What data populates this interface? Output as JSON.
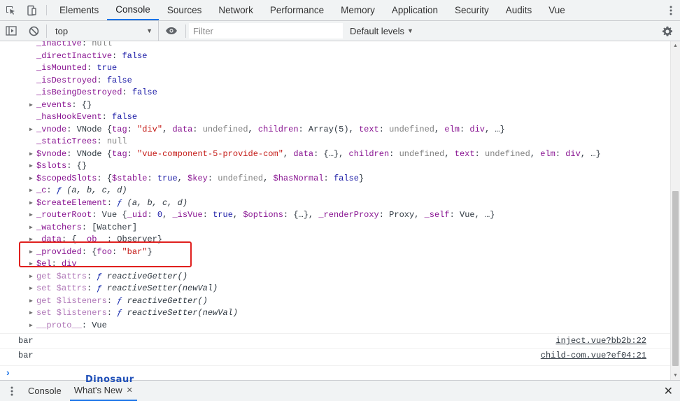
{
  "tabs": [
    {
      "label": "Elements"
    },
    {
      "label": "Console",
      "active": true
    },
    {
      "label": "Sources"
    },
    {
      "label": "Network"
    },
    {
      "label": "Performance"
    },
    {
      "label": "Memory"
    },
    {
      "label": "Application"
    },
    {
      "label": "Security"
    },
    {
      "label": "Audits"
    },
    {
      "label": "Vue"
    }
  ],
  "toolbar": {
    "context": "top",
    "filter_placeholder": "Filter",
    "levels": "Default levels"
  },
  "props": [
    {
      "k": "_inactive",
      "v": [
        [
          "nul",
          "null"
        ]
      ]
    },
    {
      "k": "_directInactive",
      "v": [
        [
          "kw",
          "false"
        ]
      ]
    },
    {
      "k": "_isMounted",
      "v": [
        [
          "kw",
          "true"
        ]
      ]
    },
    {
      "k": "_isDestroyed",
      "v": [
        [
          "kw",
          "false"
        ]
      ]
    },
    {
      "k": "_isBeingDestroyed",
      "v": [
        [
          "kw",
          "false"
        ]
      ]
    },
    {
      "k": "_events",
      "tri": true,
      "v": [
        [
          "pv",
          "{}"
        ]
      ]
    },
    {
      "k": "_hasHookEvent",
      "v": [
        [
          "kw",
          "false"
        ]
      ]
    },
    {
      "k": "_vnode",
      "tri": true,
      "v": [
        [
          "pv",
          "VNode {"
        ],
        [
          "k",
          "tag"
        ],
        [
          "pv",
          ": "
        ],
        [
          "str",
          "\"div\""
        ],
        [
          "pv",
          ", "
        ],
        [
          "k",
          "data"
        ],
        [
          "pv",
          ": "
        ],
        [
          "nul",
          "undefined"
        ],
        [
          "pv",
          ", "
        ],
        [
          "k",
          "children"
        ],
        [
          "pv",
          ": Array(5), "
        ],
        [
          "k",
          "text"
        ],
        [
          "pv",
          ": "
        ],
        [
          "nul",
          "undefined"
        ],
        [
          "pv",
          ", "
        ],
        [
          "k",
          "elm"
        ],
        [
          "pv",
          ": "
        ],
        [
          "k",
          "div"
        ],
        [
          "pv",
          ", …}"
        ]
      ]
    },
    {
      "k": "_staticTrees",
      "v": [
        [
          "nul",
          "null"
        ]
      ]
    },
    {
      "k": "$vnode",
      "tri": true,
      "v": [
        [
          "pv",
          "VNode {"
        ],
        [
          "k",
          "tag"
        ],
        [
          "pv",
          ": "
        ],
        [
          "str",
          "\"vue-component-5-provide-com\""
        ],
        [
          "pv",
          ", "
        ],
        [
          "k",
          "data"
        ],
        [
          "pv",
          ": {…}, "
        ],
        [
          "k",
          "children"
        ],
        [
          "pv",
          ": "
        ],
        [
          "nul",
          "undefined"
        ],
        [
          "pv",
          ", "
        ],
        [
          "k",
          "text"
        ],
        [
          "pv",
          ": "
        ],
        [
          "nul",
          "undefined"
        ],
        [
          "pv",
          ", "
        ],
        [
          "k",
          "elm"
        ],
        [
          "pv",
          ": "
        ],
        [
          "k",
          "div"
        ],
        [
          "pv",
          ", …}"
        ]
      ]
    },
    {
      "k": "$slots",
      "tri": true,
      "v": [
        [
          "pv",
          "{}"
        ]
      ]
    },
    {
      "k": "$scopedSlots",
      "tri": true,
      "v": [
        [
          "pv",
          "{"
        ],
        [
          "k",
          "$stable"
        ],
        [
          "pv",
          ": "
        ],
        [
          "kw",
          "true"
        ],
        [
          "pv",
          ", "
        ],
        [
          "k",
          "$key"
        ],
        [
          "pv",
          ": "
        ],
        [
          "nul",
          "undefined"
        ],
        [
          "pv",
          ", "
        ],
        [
          "k",
          "$hasNormal"
        ],
        [
          "pv",
          ": "
        ],
        [
          "kw",
          "false"
        ],
        [
          "pv",
          "}"
        ]
      ]
    },
    {
      "k": "_c",
      "tri": true,
      "v": [
        [
          "fnf",
          "ƒ"
        ],
        [
          "fn",
          " (a, b, c, d)"
        ]
      ]
    },
    {
      "k": "$createElement",
      "tri": true,
      "v": [
        [
          "fnf",
          "ƒ"
        ],
        [
          "fn",
          " (a, b, c, d)"
        ]
      ]
    },
    {
      "k": "_routerRoot",
      "tri": true,
      "v": [
        [
          "pv",
          "Vue {"
        ],
        [
          "k",
          "_uid"
        ],
        [
          "pv",
          ": "
        ],
        [
          "kw",
          "0"
        ],
        [
          "pv",
          ", "
        ],
        [
          "k",
          "_isVue"
        ],
        [
          "pv",
          ": "
        ],
        [
          "kw",
          "true"
        ],
        [
          "pv",
          ", "
        ],
        [
          "k",
          "$options"
        ],
        [
          "pv",
          ": {…}, "
        ],
        [
          "k",
          "_renderProxy"
        ],
        [
          "pv",
          ": Proxy, "
        ],
        [
          "k",
          "_self"
        ],
        [
          "pv",
          ": Vue, …}"
        ]
      ]
    },
    {
      "k": "_watchers",
      "tri": true,
      "v": [
        [
          "pv",
          "[Watcher]"
        ]
      ]
    },
    {
      "k": "_data",
      "tri": true,
      "v": [
        [
          "pv",
          "{"
        ],
        [
          "k",
          "__ob__"
        ],
        [
          "pv",
          ": Observer}"
        ]
      ]
    },
    {
      "k": "_provided",
      "tri": true,
      "v": [
        [
          "pv",
          "{"
        ],
        [
          "k",
          "foo"
        ],
        [
          "pv",
          ": "
        ],
        [
          "str",
          "\"bar\""
        ],
        [
          "pv",
          "}"
        ]
      ]
    },
    {
      "k": "$el",
      "tri": true,
      "v": [
        [
          "k",
          "div"
        ]
      ]
    },
    {
      "k": "get $attrs",
      "tri": true,
      "dim": true,
      "v": [
        [
          "fnf",
          "ƒ"
        ],
        [
          "fn",
          " reactiveGetter()"
        ]
      ]
    },
    {
      "k": "set $attrs",
      "tri": true,
      "dim": true,
      "v": [
        [
          "fnf",
          "ƒ"
        ],
        [
          "fn",
          " reactiveSetter(newVal)"
        ]
      ]
    },
    {
      "k": "get $listeners",
      "tri": true,
      "dim": true,
      "v": [
        [
          "fnf",
          "ƒ"
        ],
        [
          "fn",
          " reactiveGetter()"
        ]
      ]
    },
    {
      "k": "set $listeners",
      "tri": true,
      "dim": true,
      "v": [
        [
          "fnf",
          "ƒ"
        ],
        [
          "fn",
          " reactiveSetter(newVal)"
        ]
      ]
    },
    {
      "k": "__proto__",
      "tri": true,
      "dim": true,
      "v": [
        [
          "pv",
          "Vue"
        ]
      ]
    }
  ],
  "logs": [
    {
      "msg": "bar",
      "src": "inject.vue?bb2b:22"
    },
    {
      "msg": "bar",
      "src": "child-com.vue?ef04:21"
    }
  ],
  "drawer": {
    "tabs": [
      {
        "label": "Console"
      },
      {
        "label": "What's New",
        "active": true
      }
    ]
  },
  "watermark": "Dinosaur",
  "icons": {
    "inspect": "inspect-element-icon",
    "device": "device-toolbar-icon",
    "sidebar": "show-sidebar-icon",
    "clear": "clear-console-icon",
    "eye": "live-expression-icon",
    "gear": "settings-gear-icon"
  },
  "colors": {
    "accent": "#1a73e8",
    "key": "#881391",
    "string": "#c41a16",
    "keyword": "#1a1aa6",
    "highlight": "#e0201e"
  }
}
